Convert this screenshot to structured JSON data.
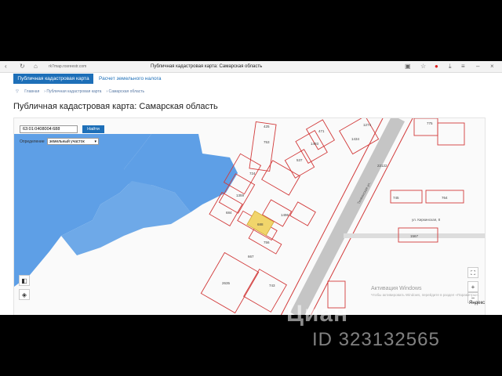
{
  "browser": {
    "url": "rk7map.rosreestr.com",
    "page_title": "Публичная кадастровая карта: Самарская область"
  },
  "nav": {
    "active_tab": "Публичная кадастровая карта",
    "calc_tab": "Расчет земельного налога"
  },
  "breadcrumbs": [
    "Главная",
    "Публичная кадастровая карта",
    "Самарская область"
  ],
  "page_heading": "Публичная кадастровая карта: Самарская область",
  "search": {
    "value": "63:01:0408004:688",
    "button": "Найти",
    "define_label": "Определение",
    "type_value": "земельный участок"
  },
  "map": {
    "parcels": [
      "425",
      "753",
      "1274",
      "775",
      "471",
      "1493",
      "1434",
      "537",
      "724",
      "1359",
      "684",
      "688",
      "1496",
      "22122",
      "745",
      "764",
      "756",
      "667",
      "1567",
      "2635",
      "743"
    ],
    "street_labels": [
      "Тихвинская ул.",
      "ул. Киркинская, 8"
    ],
    "yandex": "Яндекс",
    "activation_title": "Активация Windows",
    "activation_sub": "Чтобы активировать Windows, перейдите в раздел «Параметры».",
    "colors": {
      "water": "#5e9fe6",
      "parcel_stroke": "#d23a3a",
      "selected_fill": "#f1d56b",
      "nav_blue": "#1d6fb8"
    }
  },
  "watermark": {
    "brand": "Циан",
    "id": "ID 323132565"
  }
}
